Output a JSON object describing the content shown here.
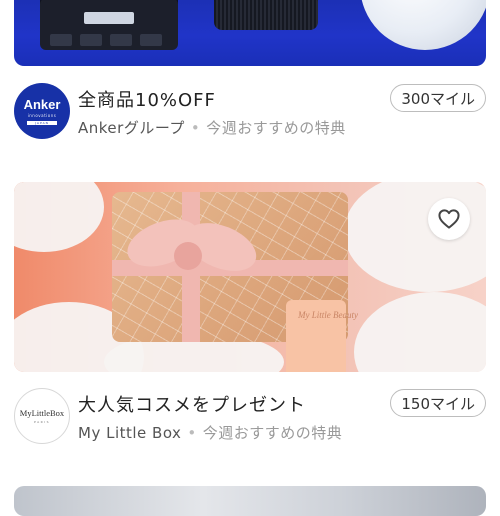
{
  "offers": [
    {
      "title": "全商品10%OFF",
      "brand": "Ankerグループ",
      "tag": "今週おすすめの特典",
      "miles": "300マイル",
      "logo": {
        "word": "Anker",
        "sub": "innovations",
        "bar": "JAPAN"
      }
    },
    {
      "title": "大人気コスメをプレゼント",
      "brand": "My Little Box",
      "tag": "今週おすすめの特典",
      "miles": "150マイル",
      "logo": {
        "word": "MyLittleBox",
        "sub": "PARIS"
      },
      "favorite_icon": "heart-outline-icon",
      "product_label": "My Little Beauty"
    }
  ]
}
